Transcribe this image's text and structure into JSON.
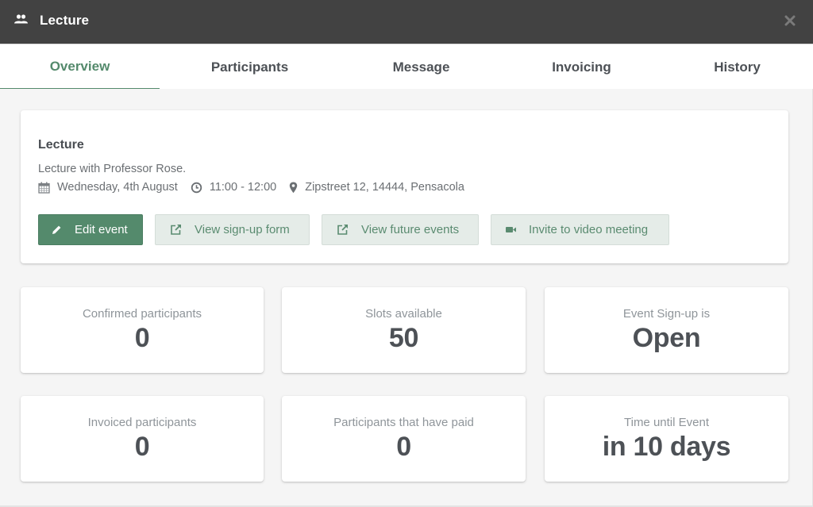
{
  "window": {
    "title": "Lecture",
    "title_icon": "group-icon",
    "close_icon": "close-icon"
  },
  "tabs": [
    {
      "label": "Overview",
      "active": true
    },
    {
      "label": "Participants",
      "active": false
    },
    {
      "label": "Message",
      "active": false
    },
    {
      "label": "Invoicing",
      "active": false
    },
    {
      "label": "History",
      "active": false
    }
  ],
  "event": {
    "title": "Lecture",
    "description": "Lecture with Professor Rose.",
    "date": "Wednesday, 4th August",
    "time": "11:00 - 12:00",
    "location": "Zipstreet 12, 14444, Pensacola",
    "icons": {
      "date": "calendar-icon",
      "time": "clock-icon",
      "location": "map-marker-icon"
    }
  },
  "actions": [
    {
      "label": "Edit event",
      "icon": "pencil-icon",
      "style": "primary"
    },
    {
      "label": "View sign-up form",
      "icon": "external-link-icon",
      "style": "secondary"
    },
    {
      "label": "View future events",
      "icon": "external-link-icon",
      "style": "secondary"
    },
    {
      "label": "Invite to video meeting",
      "icon": "video-camera-icon",
      "style": "secondary"
    }
  ],
  "stats": [
    {
      "label": "Confirmed participants",
      "value": "0"
    },
    {
      "label": "Slots available",
      "value": "50"
    },
    {
      "label": "Event Sign-up is",
      "value": "Open"
    },
    {
      "label": "Invoiced participants",
      "value": "0"
    },
    {
      "label": "Participants that have paid",
      "value": "0"
    },
    {
      "label": "Time until Event",
      "value": "in 10 days"
    }
  ],
  "colors": {
    "accent": "#548a6c",
    "titlebar": "#424242",
    "secondary_button_bg": "#e5ece8"
  }
}
